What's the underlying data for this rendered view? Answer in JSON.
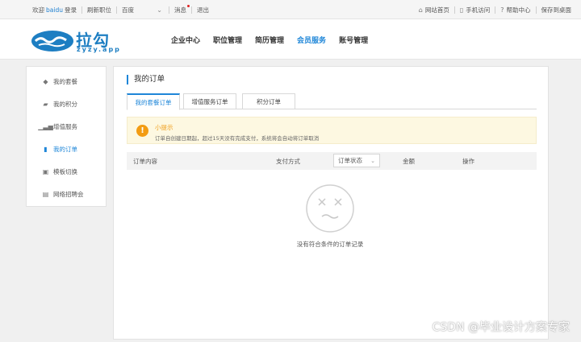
{
  "topbar": {
    "welcome": "欢迎",
    "username": "baidu",
    "login": "登录",
    "refresh_jobs": "刷新职位",
    "site_select": "百度",
    "messages": "消息",
    "logout": "退出",
    "home": "网站首页",
    "mobile": "手机访问",
    "help": "帮助中心",
    "save_desktop": "保存到桌面"
  },
  "header": {
    "logo_name": "拉勾",
    "logo_sub": "zyzy.app",
    "nav": [
      {
        "label": "企业中心"
      },
      {
        "label": "职位管理"
      },
      {
        "label": "简历管理"
      },
      {
        "label": "会员服务",
        "active": true
      },
      {
        "label": "账号管理"
      }
    ]
  },
  "sidebar": {
    "items": [
      {
        "label": "我的套餐",
        "icon": "diamond-icon"
      },
      {
        "label": "我的积分",
        "icon": "points-icon"
      },
      {
        "label": "增值服务",
        "icon": "chart-icon"
      },
      {
        "label": "我的订单",
        "icon": "order-icon",
        "active": true
      },
      {
        "label": "模板切换",
        "icon": "template-icon"
      },
      {
        "label": "网络招聘会",
        "icon": "job-fair-icon"
      }
    ]
  },
  "main": {
    "title": "我的订单",
    "tabs": [
      {
        "label": "我的套餐订单",
        "active": true
      },
      {
        "label": "增值服务订单"
      },
      {
        "label": "积分订单"
      }
    ],
    "notice": {
      "title": "小提示",
      "text": "订单自创建日期起，超过15天没有完成支付，系统将会自动将订单取消"
    },
    "table": {
      "col_content": "订单内容",
      "col_payment": "支付方式",
      "col_status": "订单状态",
      "col_amount": "金额",
      "col_action": "操作"
    },
    "empty_text": "没有符合条件的订单记录"
  },
  "watermark": "CSDN @毕业设计方案专家",
  "colors": {
    "accent": "#1e86d8",
    "warning": "#f39c12",
    "notice_bg": "#fdf8e1"
  }
}
